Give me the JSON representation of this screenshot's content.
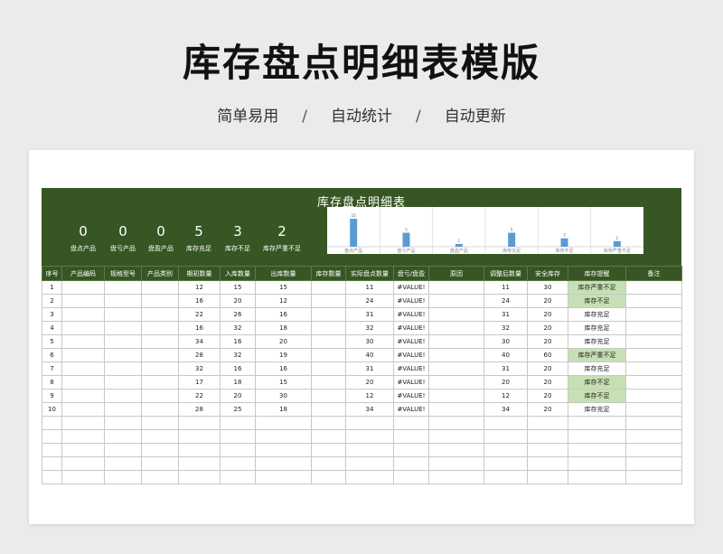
{
  "page": {
    "title": "库存盘点明细表模版",
    "subtitle_items": [
      "简单易用",
      "自动统计",
      "自动更新"
    ],
    "separator": "/"
  },
  "sheet": {
    "title": "库存盘点明细表",
    "stats": [
      {
        "value": "0",
        "label": "盘点产品"
      },
      {
        "value": "0",
        "label": "盘亏产品"
      },
      {
        "value": "0",
        "label": "盘盈产品"
      },
      {
        "value": "5",
        "label": "库存充足"
      },
      {
        "value": "3",
        "label": "库存不足"
      },
      {
        "value": "2",
        "label": "库存严重不足"
      }
    ],
    "columns": [
      "序号",
      "产品编码",
      "规格型号",
      "产品类别",
      "期初数量",
      "入库数量",
      "出库数量",
      "库存数量",
      "实际盘点数量",
      "盘亏/盘盈",
      "原因",
      "调整后数量",
      "安全库存",
      "库存提醒",
      "备注"
    ],
    "rows": [
      [
        "1",
        "",
        "",
        "",
        "12",
        "15",
        "15",
        "",
        "11",
        "#VALUE!",
        "",
        "11",
        "30",
        "库存严重不足",
        ""
      ],
      [
        "2",
        "",
        "",
        "",
        "16",
        "20",
        "12",
        "",
        "24",
        "#VALUE!",
        "",
        "24",
        "20",
        "库存不足",
        ""
      ],
      [
        "3",
        "",
        "",
        "",
        "22",
        "26",
        "16",
        "",
        "31",
        "#VALUE!",
        "",
        "31",
        "20",
        "库存充足",
        ""
      ],
      [
        "4",
        "",
        "",
        "",
        "16",
        "32",
        "18",
        "",
        "32",
        "#VALUE!",
        "",
        "32",
        "20",
        "库存充足",
        ""
      ],
      [
        "5",
        "",
        "",
        "",
        "34",
        "16",
        "20",
        "",
        "30",
        "#VALUE!",
        "",
        "30",
        "20",
        "库存充足",
        ""
      ],
      [
        "6",
        "",
        "",
        "",
        "28",
        "32",
        "19",
        "",
        "40",
        "#VALUE!",
        "",
        "40",
        "60",
        "库存严重不足",
        ""
      ],
      [
        "7",
        "",
        "",
        "",
        "32",
        "16",
        "16",
        "",
        "31",
        "#VALUE!",
        "",
        "31",
        "20",
        "库存充足",
        ""
      ],
      [
        "8",
        "",
        "",
        "",
        "17",
        "18",
        "15",
        "",
        "20",
        "#VALUE!",
        "",
        "20",
        "20",
        "库存不足",
        ""
      ],
      [
        "9",
        "",
        "",
        "",
        "22",
        "20",
        "30",
        "",
        "12",
        "#VALUE!",
        "",
        "12",
        "20",
        "库存不足",
        ""
      ],
      [
        "10",
        "",
        "",
        "",
        "28",
        "25",
        "18",
        "",
        "34",
        "#VALUE!",
        "",
        "34",
        "20",
        "库存充足",
        ""
      ],
      [
        "",
        "",
        "",
        "",
        "",
        "",
        "",
        "",
        "",
        "",
        "",
        "",
        "",
        "",
        ""
      ],
      [
        "",
        "",
        "",
        "",
        "",
        "",
        "",
        "",
        "",
        "",
        "",
        "",
        "",
        "",
        ""
      ],
      [
        "",
        "",
        "",
        "",
        "",
        "",
        "",
        "",
        "",
        "",
        "",
        "",
        "",
        "",
        ""
      ],
      [
        "",
        "",
        "",
        "",
        "",
        "",
        "",
        "",
        "",
        "",
        "",
        "",
        "",
        "",
        ""
      ],
      [
        "",
        "",
        "",
        "",
        "",
        "",
        "",
        "",
        "",
        "",
        "",
        "",
        "",
        "",
        ""
      ]
    ]
  },
  "chart_data": {
    "type": "bar",
    "categories": [
      "盘点产品",
      "盘亏产品",
      "盘盈产品",
      "库存充足",
      "库存不足",
      "库存严重不足"
    ],
    "values": [
      10,
      5,
      1,
      5,
      3,
      2
    ],
    "ylim": [
      0,
      11
    ],
    "bar_color": "#5b9bd5"
  },
  "colors": {
    "header_green": "#375623",
    "warn_fill": "#c6e0b4"
  }
}
